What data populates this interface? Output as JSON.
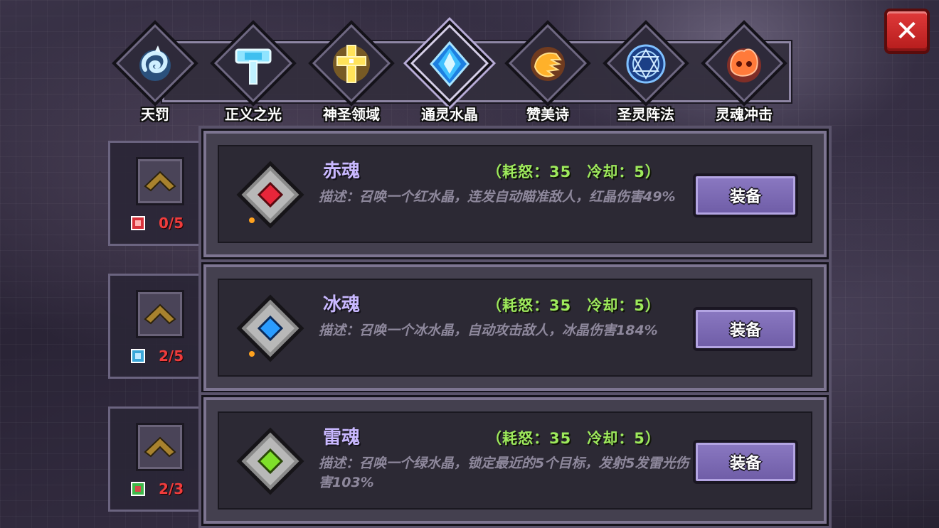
{
  "close": {
    "label": "✕"
  },
  "tabs": [
    {
      "label": "天罚",
      "icon": "blue-swirl-icon",
      "color": "#9fe6ff",
      "active": false
    },
    {
      "label": "正义之光",
      "icon": "hammer-icon",
      "color": "#6fd6ff",
      "active": false
    },
    {
      "label": "神圣领域",
      "icon": "holy-cross-icon",
      "color": "#ffd84a",
      "active": false
    },
    {
      "label": "通灵水晶",
      "icon": "crystal-icon",
      "color": "#3ab6ff",
      "active": true
    },
    {
      "label": "赞美诗",
      "icon": "fire-hand-icon",
      "color": "#ffa21f",
      "active": false
    },
    {
      "label": "圣灵阵法",
      "icon": "magic-circle-icon",
      "color": "#5aa8ff",
      "active": false
    },
    {
      "label": "灵魂冲击",
      "icon": "flame-skull-icon",
      "color": "#ff6a2a",
      "active": false
    }
  ],
  "skills": [
    {
      "name": "赤魂",
      "cost": "（耗怒：35　冷却：5）",
      "desc": "描述：召唤一个红水晶，连发自动瞄准敌人，红晶伤害49%",
      "equip": "装备",
      "level": "0/5",
      "gem_color": "#e8263a",
      "book_color": "#d8313a"
    },
    {
      "name": "冰魂",
      "cost": "（耗怒：35　冷却：5）",
      "desc": "描述：召唤一个冰水晶，自动攻击敌人，冰晶伤害184%",
      "equip": "装备",
      "level": "2/5",
      "gem_color": "#2a9cff",
      "book_color": "#3aa6d8"
    },
    {
      "name": "雷魂",
      "cost": "（耗怒：35　冷却：5）",
      "desc": "描述：召唤一个绿水晶，锁定最近的5个目标，发射5发雷光伤害103%",
      "equip": "装备",
      "level": "2/3",
      "gem_color": "#7fe02a",
      "book_color": "#3fb84a"
    }
  ]
}
